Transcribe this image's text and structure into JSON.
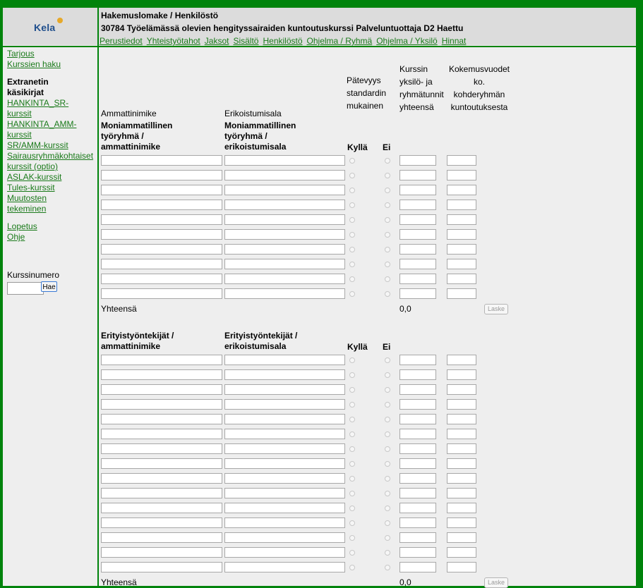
{
  "header": {
    "logo": "Kela",
    "title": "Hakemuslomake / Henkilöstö",
    "subtitle": "30784 Työelämässä olevien hengityssairaiden kuntoutuskurssi Palveluntuottaja D2 Haettu",
    "tabs": [
      "Perustiedot",
      "Yhteistyötahot",
      "Jaksot",
      "Sisältö",
      "Henkilöstö",
      "Ohjelma / Ryhmä",
      "Ohjelma / Yksilö",
      "Hinnat"
    ]
  },
  "sidebar": {
    "links_top": [
      "Tarjous",
      "Kurssien haku"
    ],
    "section_title": "Extranetin käsikirjat",
    "manual_links": [
      "HANKINTA_SR-kurssit",
      "HANKINTA_AMM-kurssit",
      "SR/AMM-kurssit",
      "Sairausryhmäkohtaiset kurssit (optio)",
      "ASLAK-kurssit",
      "Tules-kurssit",
      "Muutosten tekeminen"
    ],
    "links_bottom": [
      "Lopetus",
      "Ohje"
    ],
    "search_label": "Kurssinumero",
    "search_value": "",
    "search_button": "Hae"
  },
  "columns": {
    "ammattinimike": "Ammattinimike",
    "erikoistumisala": "Erikoistumisala",
    "patevyys": "Pätevyys standardin mukainen",
    "kurssin_tunnit": "Kurssin yksilö- ja ryhmätunnit yhteensä",
    "kokemus": "Kokemusvuodet ko. kohderyhmän kuntoutuksesta"
  },
  "section1": {
    "col1": "Moniammatillinen työryhmä / ammattinimike",
    "col2": "Moniammatillinen työryhmä / erikoistumisala",
    "yes": "Kyllä",
    "no": "Ei",
    "row_count": 10,
    "total_label": "Yhteensä",
    "total_value": "0,0",
    "button": "Laske"
  },
  "section2": {
    "col1": "Erityistyöntekijät / ammattinimike",
    "col2": "Erityistyöntekijät / erikoistumisala",
    "yes": "Kyllä",
    "no": "Ei",
    "row_count": 15,
    "total_label": "Yhteensä",
    "total_value": "0,0",
    "button": "Laske"
  }
}
